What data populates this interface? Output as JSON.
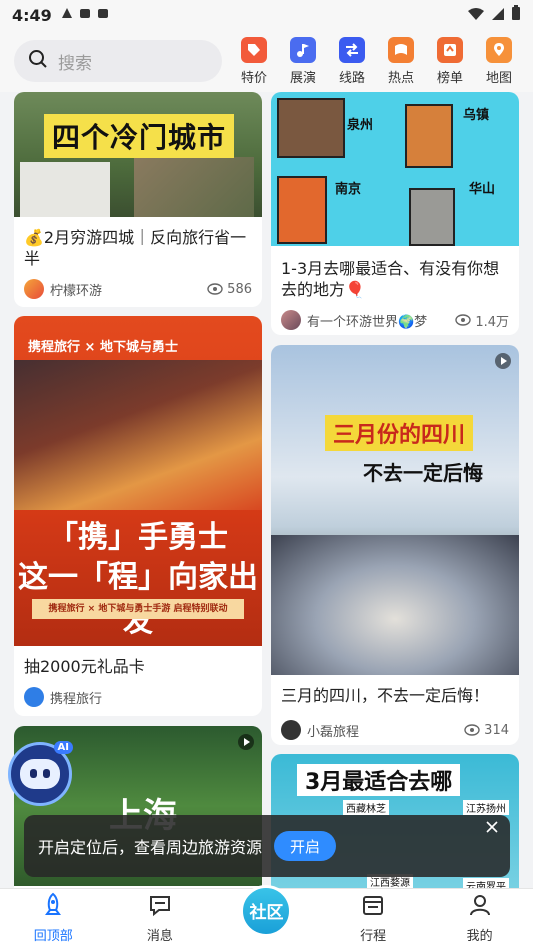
{
  "status_bar": {
    "time": "4:49"
  },
  "search": {
    "placeholder": "搜索"
  },
  "categories": [
    {
      "label": "特价",
      "icon": "tag-icon",
      "color": "#f25a3a"
    },
    {
      "label": "展演",
      "icon": "music-icon",
      "color": "#4a6cf0"
    },
    {
      "label": "线路",
      "icon": "route-icon",
      "color": "#3b5bf0"
    },
    {
      "label": "热点",
      "icon": "fire-flag-icon",
      "color": "#f37f33"
    },
    {
      "label": "榜单",
      "icon": "ranking-icon",
      "color": "#ef6b34"
    },
    {
      "label": "地图",
      "icon": "map-pin-icon",
      "color": "#f6913a"
    }
  ],
  "feed": [
    {
      "image_text": "四个冷门城市",
      "title": "💰2月穷游四城｜反向旅行省一半",
      "author": "柠檬环游",
      "views": "586"
    },
    {
      "image_labels": [
        "泉州",
        "乌镇",
        "南京",
        "华山"
      ],
      "title": "1-3月去哪最适合、有没有你想去的地方🎈",
      "author": "有一个环游世界🌍梦",
      "views": "1.4万"
    },
    {
      "image_logo": "携程旅行 × 地下城与勇士",
      "image_line1": "「携」手勇士",
      "image_line2": "这一「程」向家出发",
      "image_strip": "携程旅行 × 地下城与勇士手游 启程特别联动",
      "title": "抽2000元礼品卡",
      "author": "携程旅行"
    },
    {
      "image_line1": "三月份的四川",
      "image_line2": "不去一定后悔",
      "title": "三月的四川，不去一定后悔！",
      "author": "小磊旅程",
      "views": "314"
    },
    {
      "image_text": "上海"
    },
    {
      "image_text": "3月最适合去哪",
      "image_labels": [
        "西藏林芝",
        "江苏扬州",
        "江西婺源",
        "云南罗平"
      ]
    }
  ],
  "ai_assistant": {
    "badge": "AI"
  },
  "toast": {
    "message": "开启定位后，查看周边旅游资源",
    "button": "开启"
  },
  "bottom_nav": [
    {
      "label": "回顶部",
      "icon": "rocket-icon",
      "active": true
    },
    {
      "label": "消息",
      "icon": "message-icon"
    },
    {
      "label": "社区",
      "icon": "community-icon"
    },
    {
      "label": "行程",
      "icon": "itinerary-icon"
    },
    {
      "label": "我的",
      "icon": "profile-icon"
    }
  ]
}
